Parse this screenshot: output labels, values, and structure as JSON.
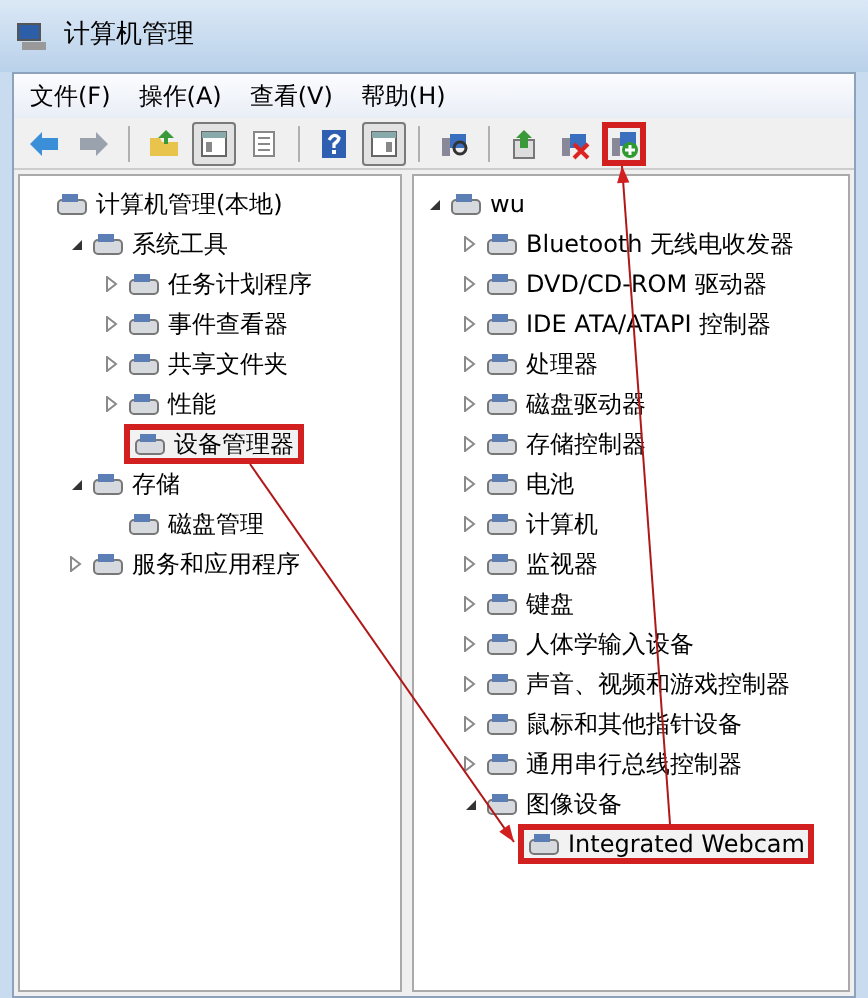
{
  "window": {
    "title": "计算机管理"
  },
  "menu": [
    "文件(F)",
    "操作(A)",
    "查看(V)",
    "帮助(H)"
  ],
  "toolbar": {
    "groups": [
      [
        {
          "pressed": false,
          "highlighted": false
        },
        {
          "pressed": false,
          "highlighted": false
        }
      ],
      [
        {
          "pressed": false,
          "highlighted": false
        },
        {
          "pressed": true,
          "highlighted": false
        },
        {
          "pressed": false,
          "highlighted": false
        }
      ],
      [
        {
          "pressed": false,
          "highlighted": false
        },
        {
          "pressed": true,
          "highlighted": false
        }
      ],
      [
        {
          "pressed": false,
          "highlighted": false
        }
      ],
      [
        {
          "pressed": false,
          "highlighted": false
        },
        {
          "pressed": false,
          "highlighted": false
        },
        {
          "pressed": false,
          "highlighted": true
        }
      ]
    ]
  },
  "console_tree": [
    {
      "label": "计算机管理(本地)",
      "children": [
        {
          "label": "系统工具",
          "expanded": true,
          "children": [
            {
              "label": "任务计划程序",
              "expanded": false
            },
            {
              "label": "事件查看器",
              "expanded": false
            },
            {
              "label": "共享文件夹",
              "expanded": false
            },
            {
              "label": "性能",
              "expanded": false
            },
            {
              "label": "设备管理器",
              "highlighted": true
            }
          ]
        },
        {
          "label": "存储",
          "expanded": true,
          "children": [
            {
              "label": "磁盘管理"
            }
          ]
        },
        {
          "label": "服务和应用程序",
          "expanded": false
        }
      ]
    }
  ],
  "device_tree": [
    {
      "label": "wu",
      "expanded": true,
      "children": [
        {
          "label": "Bluetooth 无线电收发器",
          "expanded": false
        },
        {
          "label": "DVD/CD-ROM 驱动器",
          "expanded": false
        },
        {
          "label": "IDE ATA/ATAPI 控制器",
          "expanded": false
        },
        {
          "label": "处理器",
          "expanded": false
        },
        {
          "label": "磁盘驱动器",
          "expanded": false
        },
        {
          "label": "存储控制器",
          "expanded": false
        },
        {
          "label": "电池",
          "expanded": false
        },
        {
          "label": "计算机",
          "expanded": false
        },
        {
          "label": "监视器",
          "expanded": false
        },
        {
          "label": "键盘",
          "expanded": false
        },
        {
          "label": "人体学输入设备",
          "expanded": false
        },
        {
          "label": "声音、视频和游戏控制器",
          "expanded": false
        },
        {
          "label": "鼠标和其他指针设备",
          "expanded": false
        },
        {
          "label": "通用串行总线控制器",
          "expanded": false
        },
        {
          "label": "图像设备",
          "expanded": true,
          "children": [
            {
              "label": "Integrated Webcam",
              "highlighted": true
            }
          ]
        }
      ]
    }
  ]
}
